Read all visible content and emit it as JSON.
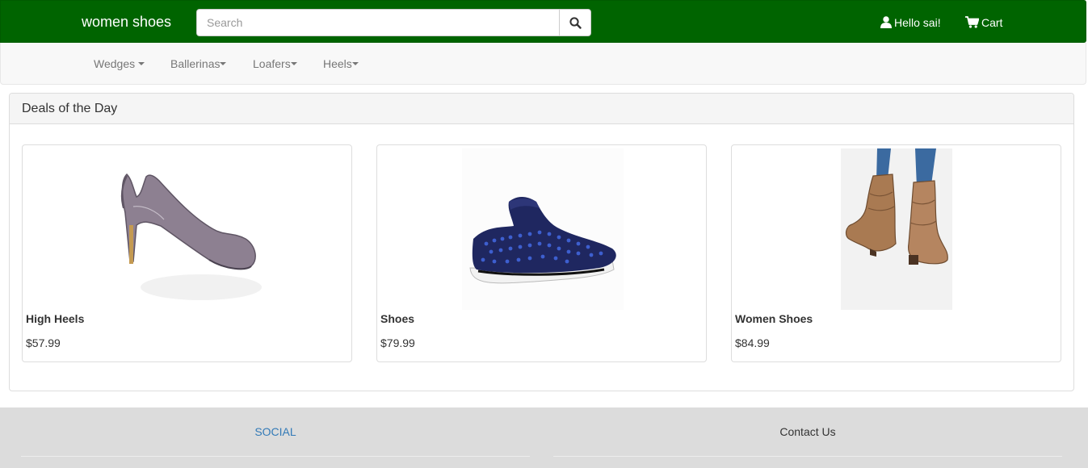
{
  "header": {
    "brand": "women shoes",
    "search_placeholder": "Search",
    "user_greeting": "Hello sai!",
    "cart_label": "Cart"
  },
  "menu": [
    {
      "label": "Wedges"
    },
    {
      "label": "Ballerinas"
    },
    {
      "label": "Loafers"
    },
    {
      "label": "Heels"
    }
  ],
  "deals": {
    "title": "Deals of the Day",
    "products": [
      {
        "name": "High Heels",
        "price": "$57.99"
      },
      {
        "name": "Shoes",
        "price": "$79.99"
      },
      {
        "name": "Women Shoes",
        "price": "$84.99"
      }
    ]
  },
  "footer": {
    "social": "SOCIAL",
    "contact": "Contact Us"
  },
  "colors": {
    "header_bg": "#006400",
    "link_blue": "#337ab7",
    "footer_bg": "#dcdcdc"
  }
}
